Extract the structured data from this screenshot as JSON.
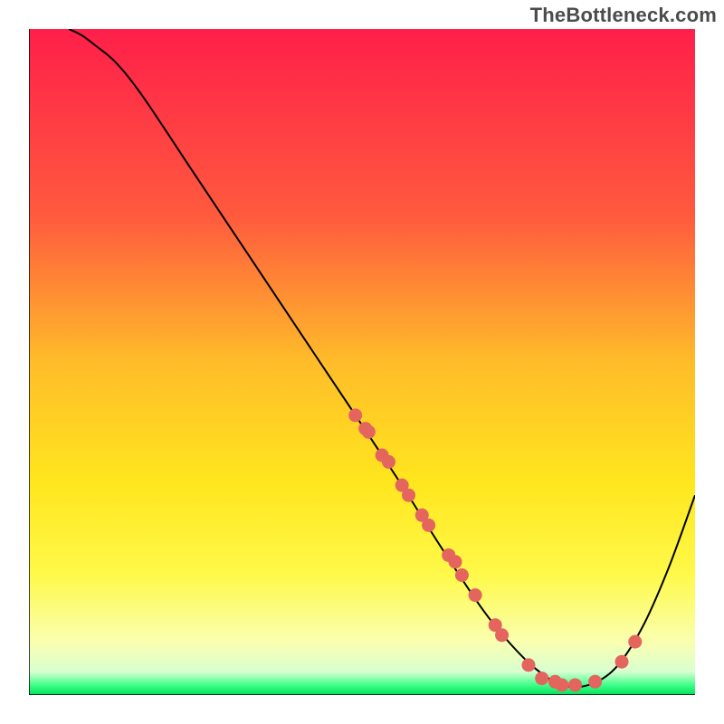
{
  "watermark": "TheBottleneck.com",
  "chart_data": {
    "type": "line",
    "title": "",
    "xlabel": "",
    "ylabel": "",
    "xlim": [
      0,
      100
    ],
    "ylim": [
      0,
      100
    ],
    "grid": false,
    "legend": false,
    "series": [
      {
        "name": "curve",
        "x": [
          6,
          8,
          10,
          13,
          17,
          25,
          35,
          45,
          55,
          62,
          68,
          72,
          76,
          80,
          84,
          88,
          92,
          96,
          100
        ],
        "y": [
          100,
          99,
          97.5,
          95,
          90,
          78,
          63,
          48,
          33,
          22,
          13,
          8,
          4,
          1.5,
          1.5,
          4,
          10,
          19,
          30
        ]
      }
    ],
    "markers": {
      "name": "highlighted-points",
      "x": [
        49,
        50.5,
        51,
        53,
        54,
        56,
        57,
        59,
        60,
        63,
        64,
        65,
        67,
        70,
        71,
        75,
        77,
        79,
        80,
        82,
        85,
        89,
        91
      ],
      "y": [
        42,
        40,
        39.5,
        36,
        35,
        31.5,
        30,
        27,
        25.5,
        21,
        20,
        18,
        15,
        10.5,
        9,
        4.5,
        2.5,
        2,
        1.5,
        1.5,
        2,
        5,
        8
      ]
    },
    "background_gradient": {
      "stops": [
        {
          "offset": 0.0,
          "color": "#ff1f4a"
        },
        {
          "offset": 0.28,
          "color": "#ff5a3e"
        },
        {
          "offset": 0.5,
          "color": "#ffbc2a"
        },
        {
          "offset": 0.68,
          "color": "#ffe61e"
        },
        {
          "offset": 0.82,
          "color": "#fff94a"
        },
        {
          "offset": 0.92,
          "color": "#faffb0"
        },
        {
          "offset": 0.965,
          "color": "#d8ffd0"
        },
        {
          "offset": 0.985,
          "color": "#3fff8a"
        },
        {
          "offset": 1.0,
          "color": "#00e05a"
        }
      ]
    }
  }
}
